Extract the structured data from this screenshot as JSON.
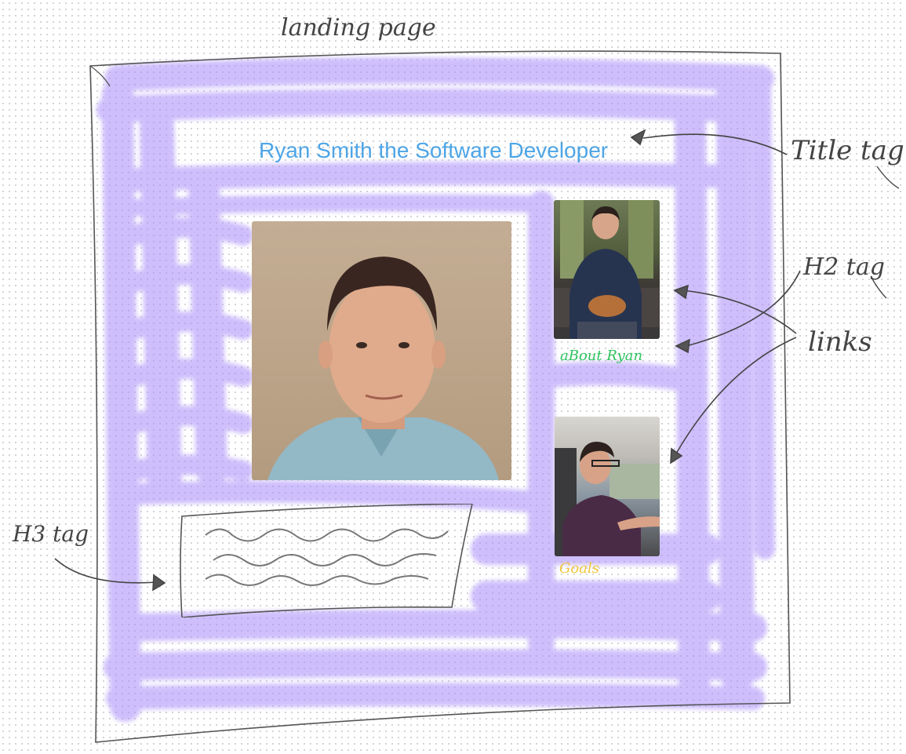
{
  "annotations": {
    "landing_page": "landing page",
    "title_tag": "Title tag",
    "h2_tag": "H2 tag",
    "links": "links",
    "h3_tag": "H3 tag"
  },
  "page": {
    "title": "Ryan Smith the Software Developer",
    "about_link": "aBout Ryan",
    "goals_link": "Goals"
  },
  "colors": {
    "title": "#4ea5e6",
    "about_link": "#2ec35f",
    "goals_link": "#f0c53a",
    "scribble": "#a78bfa"
  }
}
